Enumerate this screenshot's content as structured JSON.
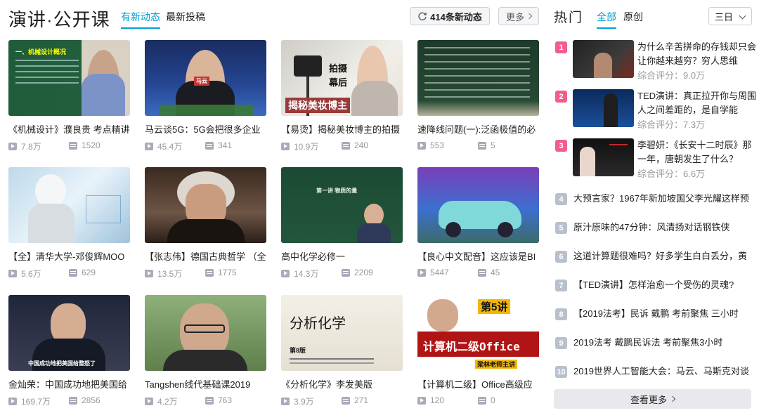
{
  "left": {
    "title": "演讲·公开课",
    "tabs": [
      {
        "label": "有新动态"
      },
      {
        "label": "最新投稿"
      }
    ],
    "refresh_label": "414条新动态",
    "more_label": "更多",
    "cards": [
      {
        "title": "《机械设计》濮良贵 考点精讲",
        "plays": "7.8万",
        "danmu": "1520"
      },
      {
        "title": "马云谈5G：5G会把很多企业",
        "plays": "45.4万",
        "danmu": "341"
      },
      {
        "title": "【易烫】揭秘美妆博主的拍摄",
        "plays": "10.9万",
        "danmu": "240"
      },
      {
        "title": "速降线问题(一):泛函极值的必",
        "plays": "553",
        "danmu": "5"
      },
      {
        "title": "【全】清华大学-邓俊辉MOO",
        "plays": "5.6万",
        "danmu": "629"
      },
      {
        "title": "【张志伟】德国古典哲学 （全",
        "plays": "13.5万",
        "danmu": "1775"
      },
      {
        "title": "高中化学必修一",
        "plays": "14.3万",
        "danmu": "2209"
      },
      {
        "title": "【良心中文配音】这应该是BI",
        "plays": "5447",
        "danmu": "45"
      },
      {
        "title": "金灿荣：中国成功地把美国给",
        "plays": "169.7万",
        "danmu": "2856"
      },
      {
        "title": "Tangshen线代基础课2019",
        "plays": "4.2万",
        "danmu": "763"
      },
      {
        "title": "《分析化学》李发美版",
        "plays": "3.9万",
        "danmu": "271"
      },
      {
        "title": "【计算机二级】Office高级应",
        "plays": "120",
        "danmu": "0"
      }
    ],
    "thumb_text": {
      "t1": "一、机械设计概况",
      "t2": "马云",
      "t3a": "拍摄",
      "t3b": "幕后",
      "t3c": "揭秘美妆博主",
      "t7": "第一讲 物质的量",
      "t9": "中国成功地把美国给整怒了",
      "t11a": "分析化学",
      "t11b": "第8版",
      "t12a": "第5讲",
      "t12b": "计算机二级Office",
      "t12c": "梁林老师主讲"
    }
  },
  "right": {
    "title": "热门",
    "tabs": [
      {
        "label": "全部"
      },
      {
        "label": "原创"
      }
    ],
    "period": "三日",
    "top": [
      {
        "num": "1",
        "title": "为什么辛苦拼命的存钱却只会让你越来越穷？穷人思维",
        "score": "综合评分：9.0万"
      },
      {
        "num": "2",
        "title": "TED演讲：真正拉开你与周围人之间差距的，是自学能",
        "score": "综合评分：7.3万"
      },
      {
        "num": "3",
        "title": "李碧妍：《长安十二时辰》那一年，唐朝发生了什么？",
        "score": "综合评分：6.6万"
      }
    ],
    "items": [
      {
        "num": "4",
        "title": "大预言家？1967年新加坡国父李光耀这样预"
      },
      {
        "num": "5",
        "title": "原汁原味的47分钟：风清扬对话钢铁侠"
      },
      {
        "num": "6",
        "title": "这道计算题很难吗？好多学生白白丢分，黄"
      },
      {
        "num": "7",
        "title": "【TED演讲】怎样治愈一个受伤的灵魂?"
      },
      {
        "num": "8",
        "title": "【2019法考】民诉 戴鹏 考前聚焦 三小时"
      },
      {
        "num": "9",
        "title": "2019法考 戴鹏民诉法 考前聚焦3小时"
      },
      {
        "num": "10",
        "title": "2019世界人工智能大会：马云、马斯克对谈"
      }
    ],
    "see_more_label": "查看更多"
  }
}
